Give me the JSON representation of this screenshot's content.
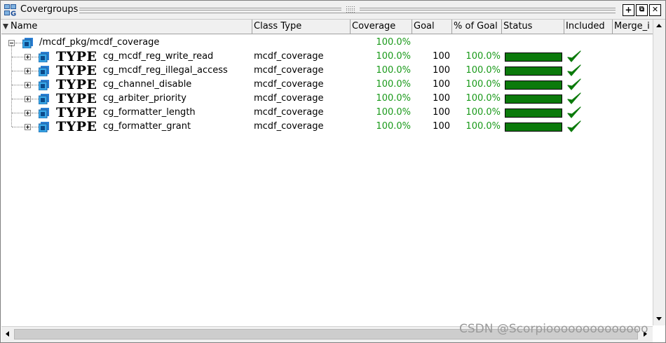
{
  "window": {
    "title": "Covergroups",
    "buttons": {
      "add": "+",
      "undock": "⧉",
      "close": "✕"
    }
  },
  "columns": [
    "Name",
    "Class Type",
    "Coverage",
    "Goal",
    "% of Goal",
    "Status",
    "Included",
    "Merge_i"
  ],
  "root": {
    "name": "/mcdf_pkg/mcdf_coverage",
    "coverage": "100.0%",
    "icon": "package-icon",
    "expanded": true
  },
  "type_tag": "TYPE",
  "rows": [
    {
      "name": "cg_mcdf_reg_write_read",
      "class_type": "mcdf_coverage",
      "coverage": "100.0%",
      "goal": "100",
      "pct_goal": "100.0%",
      "status_fill": 1.0,
      "included": "check-icon"
    },
    {
      "name": "cg_mcdf_reg_illegal_access",
      "class_type": "mcdf_coverage",
      "coverage": "100.0%",
      "goal": "100",
      "pct_goal": "100.0%",
      "status_fill": 1.0,
      "included": "check-icon"
    },
    {
      "name": "cg_channel_disable",
      "class_type": "mcdf_coverage",
      "coverage": "100.0%",
      "goal": "100",
      "pct_goal": "100.0%",
      "status_fill": 1.0,
      "included": "check-icon"
    },
    {
      "name": "cg_arbiter_priority",
      "class_type": "mcdf_coverage",
      "coverage": "100.0%",
      "goal": "100",
      "pct_goal": "100.0%",
      "status_fill": 1.0,
      "included": "check-icon"
    },
    {
      "name": "cg_formatter_length",
      "class_type": "mcdf_coverage",
      "coverage": "100.0%",
      "goal": "100",
      "pct_goal": "100.0%",
      "status_fill": 1.0,
      "included": "check-icon"
    },
    {
      "name": "cg_formatter_grant",
      "class_type": "mcdf_coverage",
      "coverage": "100.0%",
      "goal": "100",
      "pct_goal": "100.0%",
      "status_fill": 1.0,
      "included": "check-icon"
    }
  ],
  "colors": {
    "coverage_text": "#1a9a1a",
    "status_bar": "#0b7a0b",
    "check": "#0b7a0b"
  },
  "watermark": "CSDN @Scorpioooooooooooooo"
}
